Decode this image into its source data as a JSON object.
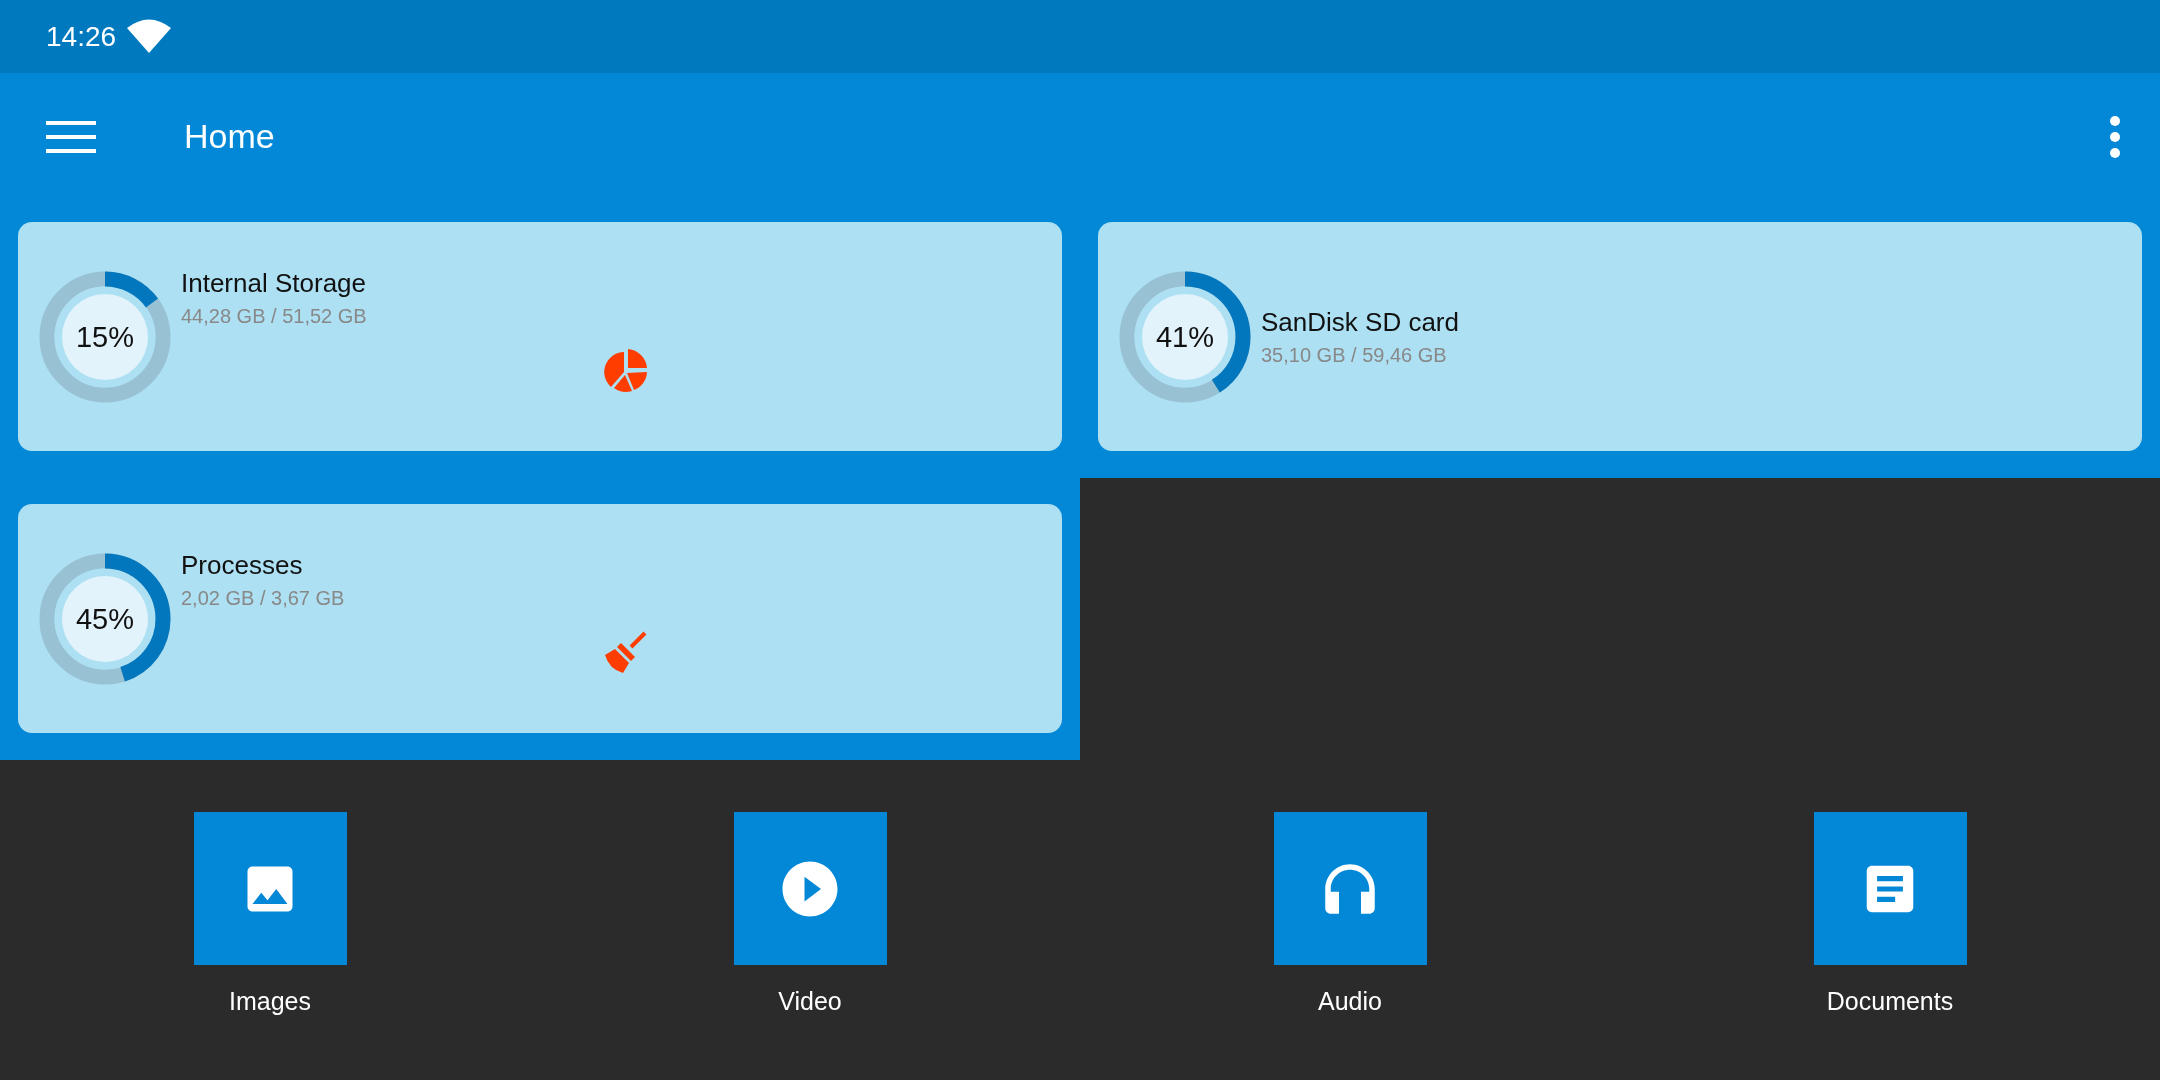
{
  "status_bar": {
    "time": "14:26"
  },
  "toolbar": {
    "title": "Home"
  },
  "cards": [
    {
      "kind": "storage",
      "title": "Internal Storage",
      "usage": "44,28 GB / 51,52 GB",
      "percent": "15%",
      "level": 0.15
    },
    {
      "kind": "removable",
      "title": "SanDisk SD card",
      "usage": "35,10 GB / 59,46 GB",
      "percent": "41%",
      "level": 0.41
    },
    {
      "kind": "memory",
      "title": "Processes",
      "usage": "2,02 GB / 3,67 GB",
      "percent": "45%",
      "level": 0.45
    }
  ],
  "categories": [
    {
      "kind": "images",
      "label": "Images"
    },
    {
      "kind": "video",
      "label": "Video"
    },
    {
      "kind": "audio",
      "label": "Audio"
    },
    {
      "kind": "documents",
      "label": "Documents"
    }
  ]
}
